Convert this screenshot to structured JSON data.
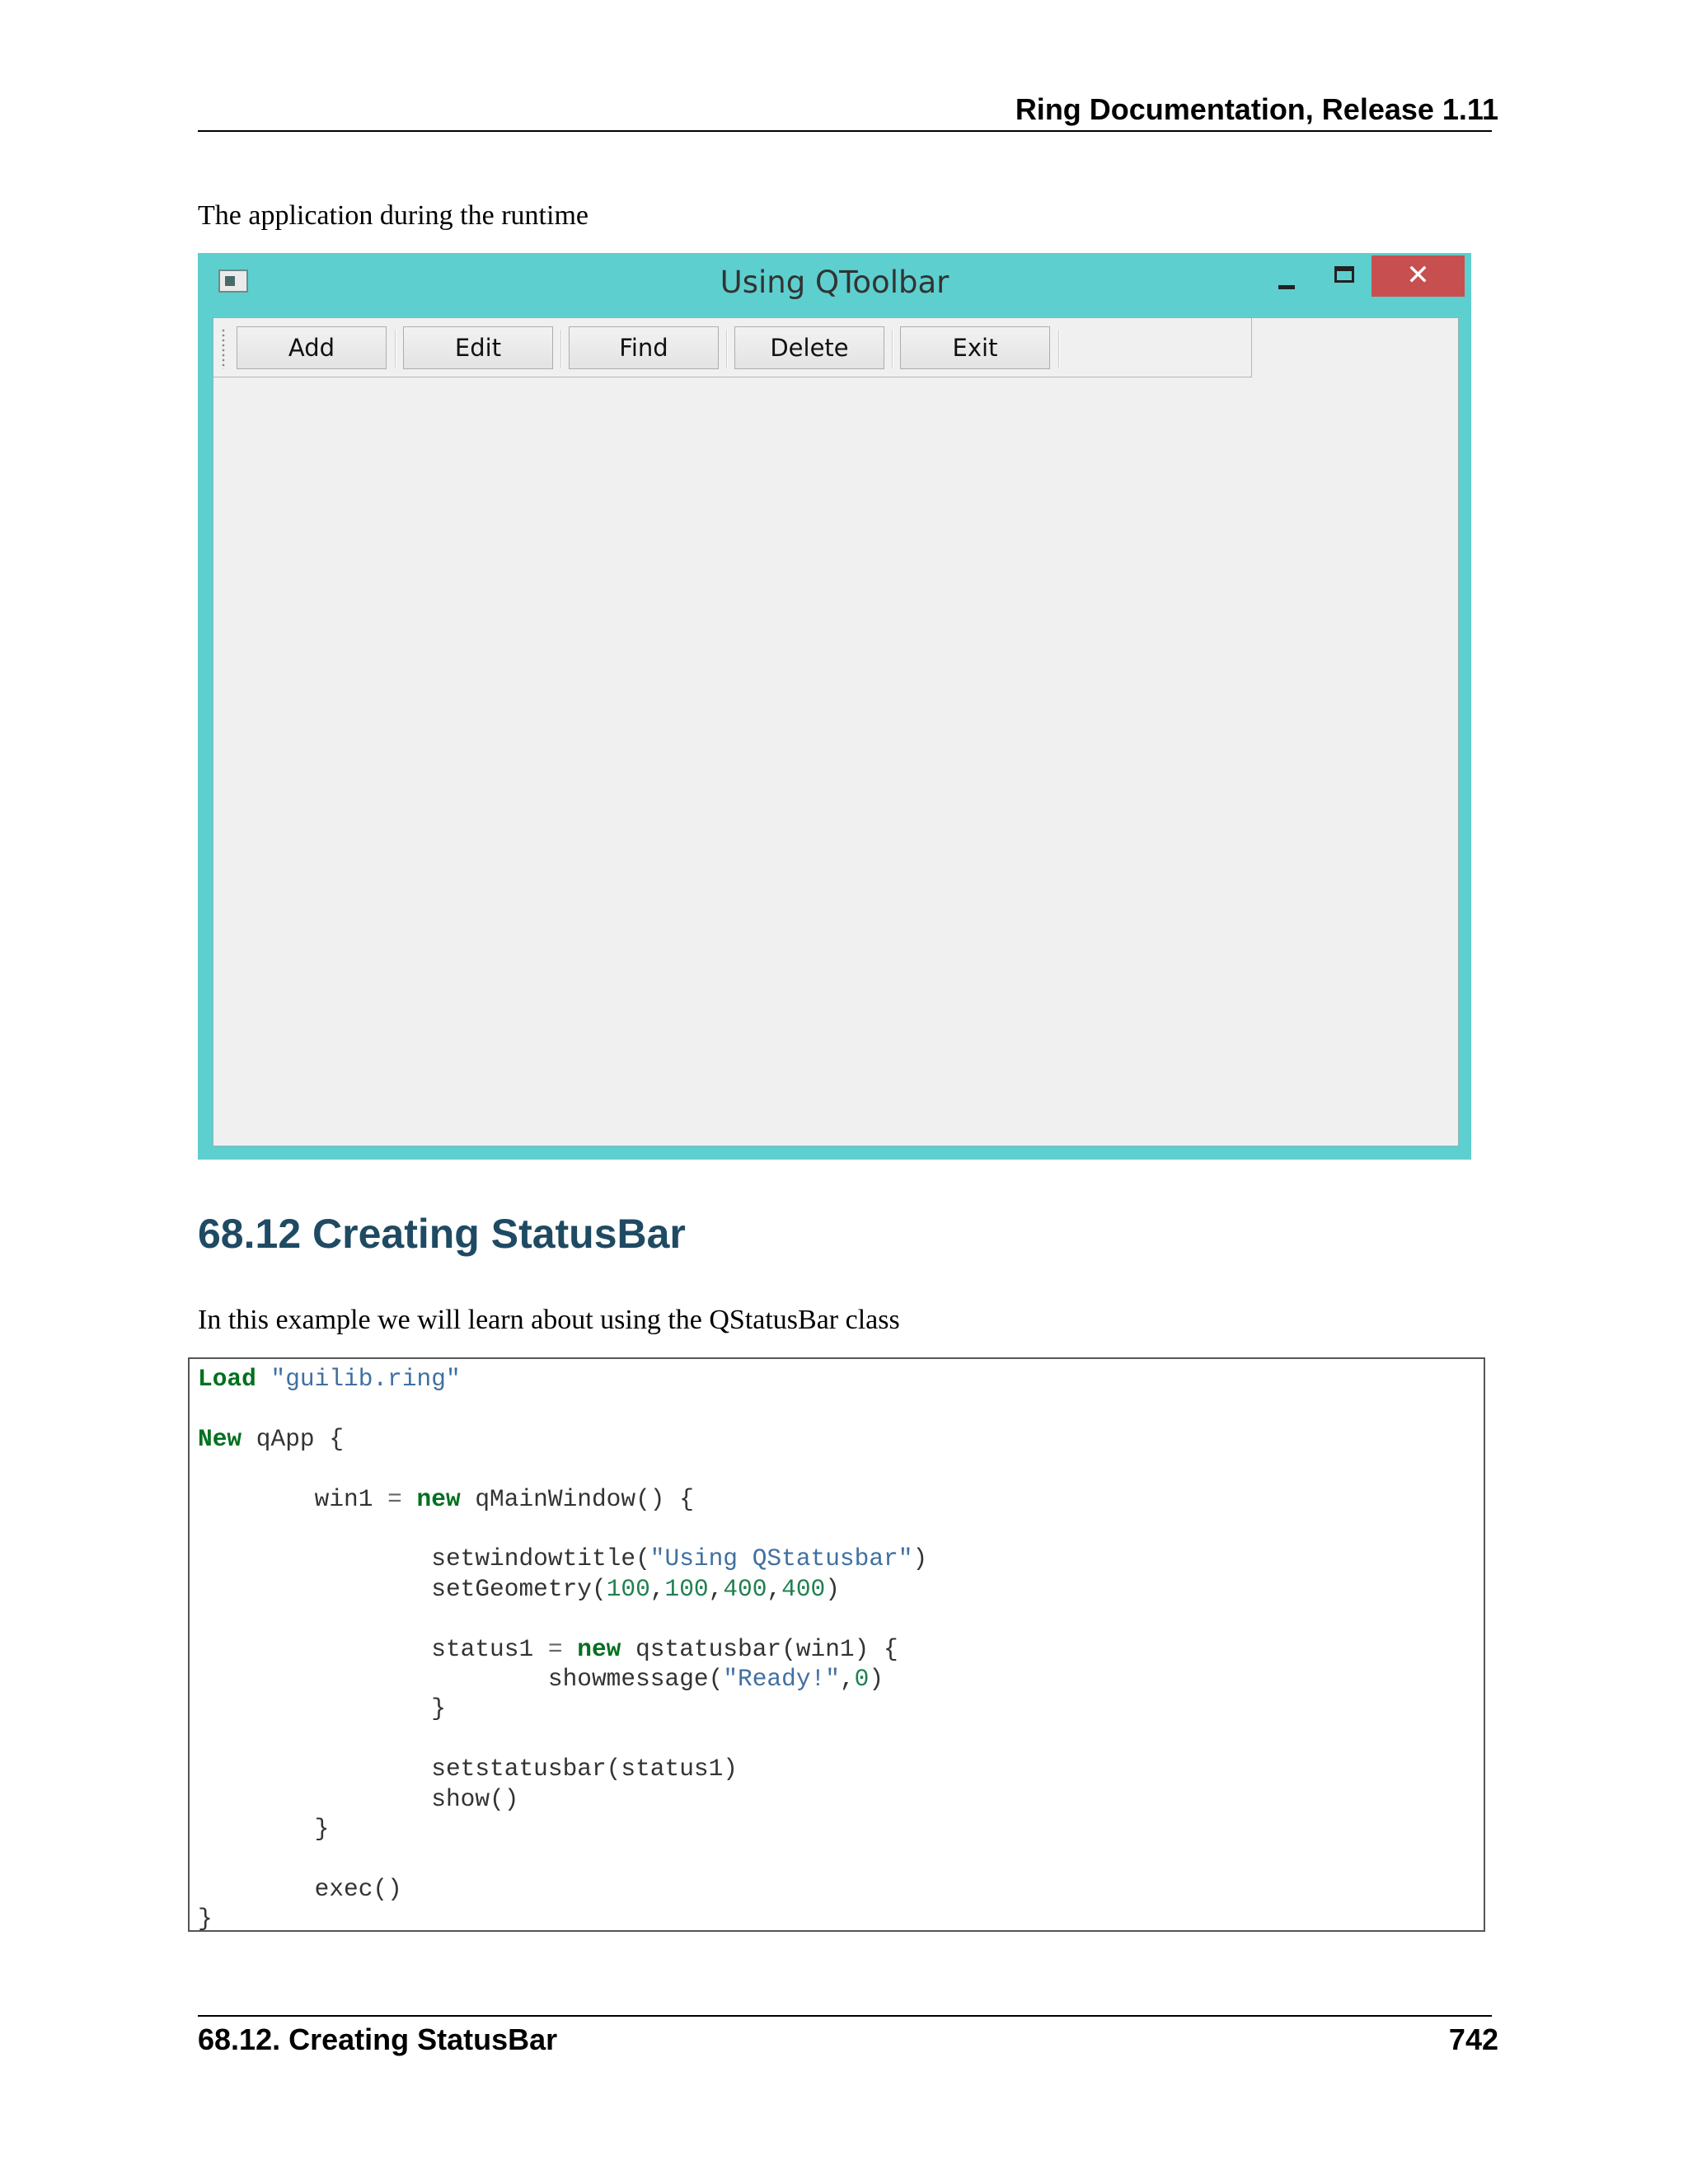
{
  "header": {
    "title": "Ring Documentation, Release 1.11"
  },
  "intro": "The application during the runtime",
  "app_window": {
    "title": "Using QToolbar",
    "close_glyph": "✕",
    "toolbar_buttons": [
      "Add",
      "Edit",
      "Find",
      "Delete",
      "Exit"
    ]
  },
  "section": {
    "heading": "68.12  Creating StatusBar",
    "text": "In this example we will learn about using the QStatusBar class"
  },
  "code": {
    "kw_load": "Load",
    "str_lib": "\"guilib.ring\"",
    "kw_new": "New",
    "t_qapp": " qApp {",
    "t_win1": "        win1 ",
    "op_eq": "=",
    "kw_new_lower": "new",
    "t_qmainwindow": " qMainWindow() {",
    "t_setwindowtitle": "                setwindowtitle(",
    "str_title": "\"Using QStatusbar\"",
    "t_close_paren": ")",
    "t_setgeometry": "                setGeometry(",
    "n_100": "100",
    "n_400": "400",
    "t_comma": ",",
    "t_status1": "                status1 ",
    "t_qstatusbar": " qstatusbar(win1) {",
    "t_showmessage": "                        showmessage(",
    "str_ready": "\"Ready!\"",
    "n_0": "0",
    "t_close_brace_inner": "                }",
    "t_setstatusbar": "                setstatusbar(status1)",
    "t_show": "                show()",
    "t_close_brace_win": "        }",
    "t_exec": "        exec()",
    "t_close_brace": "}"
  },
  "footer": {
    "left": "68.12.  Creating StatusBar",
    "right": "742"
  }
}
